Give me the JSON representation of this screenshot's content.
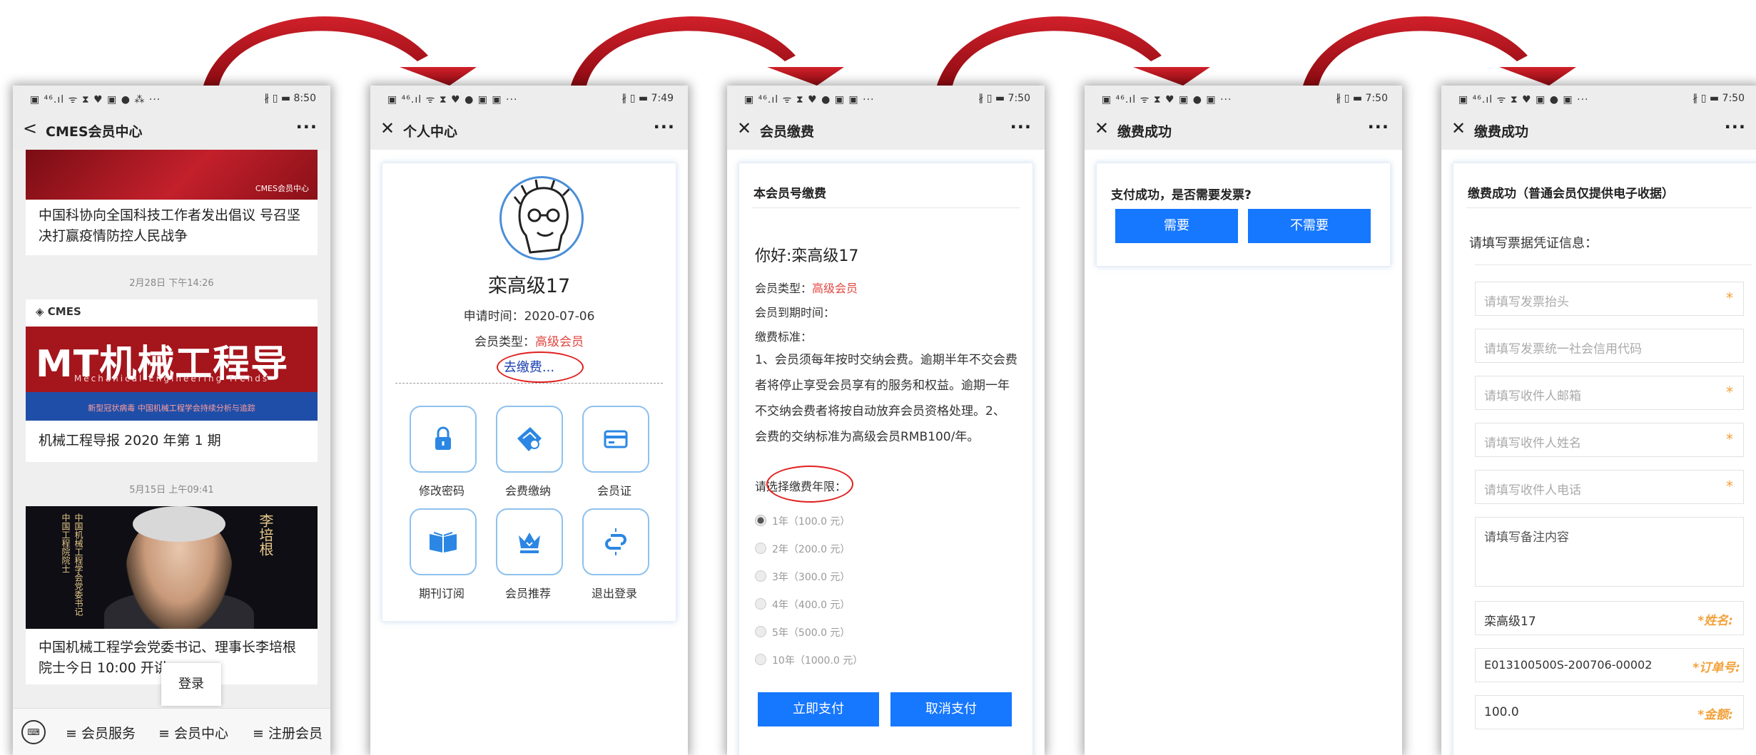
{
  "phones": [
    {
      "status_left": "▣ ⁴⁶.ıl ᯤ ⧗ ♥ ▣ ● ⁂ ···",
      "status_right": "∦ ▯ ▬ 8:50",
      "nav_back": "<",
      "title": "CMES会员中心",
      "more": "···",
      "article1_watermark": "CMES会员中心",
      "article1_title": "中国科协向全国科技工作者发出倡议 号召坚决打赢疫情防控人民战争",
      "ts2": "2月28日 下午14:26",
      "article2_logo": "◈ CMES",
      "article2_banner": "MT机械工程导报",
      "article2_banner_sub": "Mechanical Engineering Trends",
      "article2_strip": "新型冠状病毒  中国机械工程学会持续分析与追踪",
      "article2_title": "机械工程导报 2020 年第 1 期",
      "ts3": "5月15日 上午09:41",
      "article3_vtext1": "中国工程院院士",
      "article3_vtext2": "中国机械工程学会党委书记",
      "article3_name": "李培根",
      "article3_title": "中国机械工程学会党委书记、理事长李培根院士今日 10:00 开讲，",
      "tooltip": "登录",
      "keyboard": "⌨",
      "menu": [
        "≡ 会员服务",
        "≡ 会员中心",
        "≡ 注册会员"
      ]
    },
    {
      "status_left": "▣ ⁴⁶.ıl ᯤ ⧗ ♥ ● ▣ ▣ ···",
      "status_right": "∦ ▯ ▬ 7:49",
      "nav_back": "✕",
      "title": "个人中心",
      "more": "···",
      "name": "栾高级17",
      "apply_label": "申请时间：",
      "apply_date": "2020-07-06",
      "type_label": "会员类型：",
      "type_value": "高级会员",
      "pay_link": "去缴费...",
      "tiles": [
        "修改密码",
        "会费缴纳",
        "会员证",
        "期刊订阅",
        "会员推荐",
        "退出登录"
      ]
    },
    {
      "status_left": "▣ ⁴⁶.ıl ᯤ ⧗ ♥ ● ▣ ▣ ···",
      "status_right": "∦ ▯ ▬ 7:50",
      "nav_back": "✕",
      "title": "会员缴费",
      "more": "···",
      "section": "本会员号缴费",
      "greeting": "你好:栾高级17",
      "type_label": "会员类型：",
      "type_value": "高级会员",
      "expiry_label": "会员到期时间：",
      "standard_label": "缴费标准：",
      "rules": "1、会员须每年按时交纳会费。逾期半年不交会费者将停止享受会员享有的服务和权益。逾期一年不交纳会费者将按自动放弃会员资格处理。2、 会费的交纳标准为高级会员RMB100/年。",
      "choose_label": "请选择缴费年限：",
      "options": [
        "1年（100.0 元）",
        "2年（200.0 元）",
        "3年（300.0 元）",
        "4年（400.0 元）",
        "5年（500.0 元）",
        "10年（1000.0 元）"
      ],
      "pay_btn": "立即支付",
      "cancel_btn": "取消支付"
    },
    {
      "status_left": "▣ ⁴⁶.ıl ᯤ ⧗ ♥ ▣ ● ▣ ···",
      "status_right": "∦ ▯ ▬ 7:50",
      "nav_back": "✕",
      "title": "缴费成功",
      "more": "···",
      "question": "支付成功，是否需要发票?",
      "yes_btn": "需要",
      "no_btn": "不需要"
    },
    {
      "status_left": "▣ ⁴⁶.ıl ᯤ ⧗ ♥ ▣ ● ▣ ···",
      "status_right": "∦ ▯ ▬ 7:50",
      "nav_back": "✕",
      "title": "缴费成功",
      "more": "···",
      "section": "缴费成功（普通会员仅提供电子收据）",
      "fill_label": "请填写票据凭证信息：",
      "fields": [
        {
          "placeholder": "请填写发票抬头",
          "required": "*"
        },
        {
          "placeholder": "请填写发票统一社会信用代码",
          "required": ""
        },
        {
          "placeholder": "请填写收件人邮箱",
          "required": "*"
        },
        {
          "placeholder": "请填写收件人姓名",
          "required": "*"
        },
        {
          "placeholder": "请填写收件人电话",
          "required": "*"
        }
      ],
      "remark_placeholder": "请填写备注内容",
      "name_value": "栾高级17",
      "name_label": "*姓名:",
      "order_value": "E013100500S-200706-00002",
      "order_label": "*订单号:",
      "amount_value": "100.0",
      "amount_label": "*金额:"
    }
  ],
  "colors": {
    "arrow": "#b3141c",
    "accent_blue": "#1677ff",
    "highlight_red": "#e0463f"
  }
}
